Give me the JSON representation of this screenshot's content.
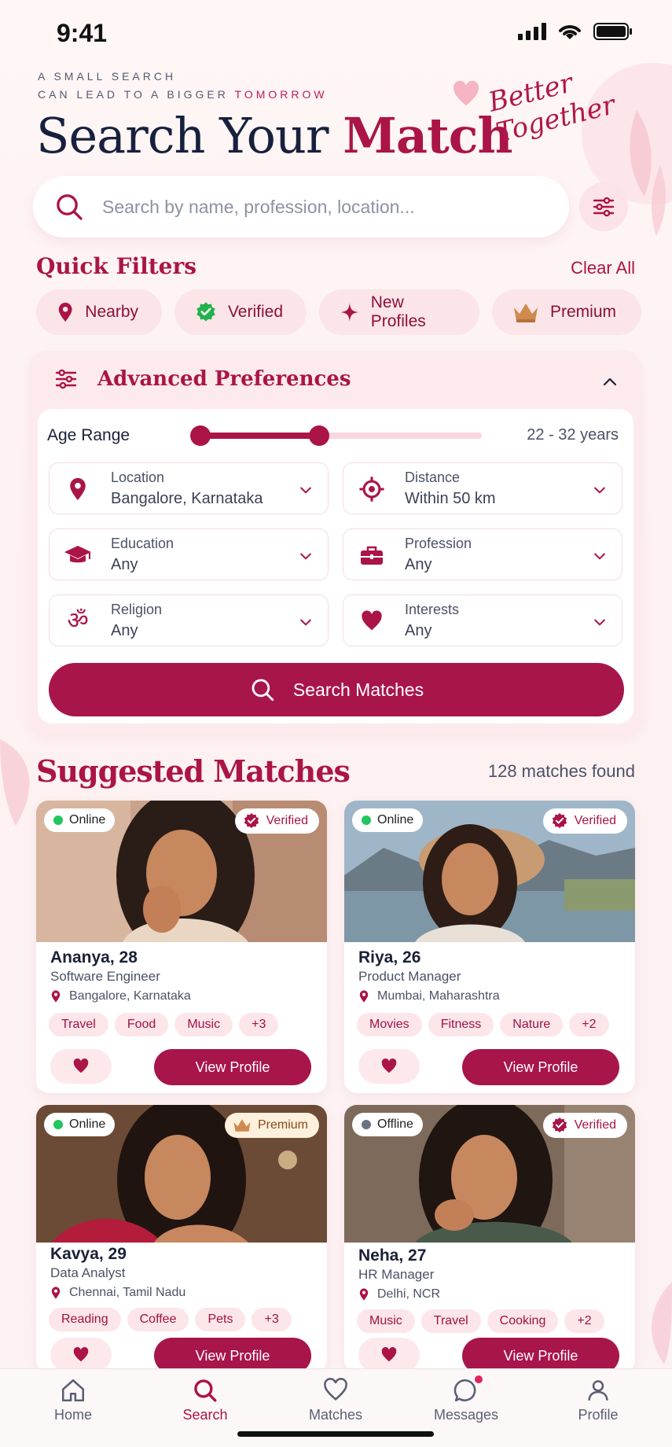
{
  "status_bar": {
    "time": "9:41"
  },
  "hero": {
    "tagline_line1": "A SMALL SEARCH",
    "tagline_line2_prefix": "CAN LEAD TO A BIGGER",
    "tagline_line2_accent": "TOMORROW",
    "title_prefix": "Search Your",
    "title_highlight": "Match",
    "script_line1": "Better",
    "script_line2": "Together"
  },
  "search": {
    "placeholder": "Search by name, profession, location..."
  },
  "quick_filters": {
    "title": "Quick Filters",
    "clear_label": "Clear All",
    "chips": [
      {
        "label": "Nearby",
        "icon": "location-pin-icon"
      },
      {
        "label": "Verified",
        "icon": "verified-check-icon"
      },
      {
        "label": "New Profiles",
        "icon": "sparkle-icon"
      },
      {
        "label": "Premium",
        "icon": "crown-icon"
      }
    ]
  },
  "advanced": {
    "title": "Advanced Preferences",
    "age_label": "Age Range",
    "age_value": "22 - 32 years",
    "fields": [
      {
        "label": "Location",
        "value": "Bangalore, Karnataka",
        "icon": "location-pin-icon"
      },
      {
        "label": "Distance",
        "value": "Within 50 km",
        "icon": "target-icon"
      },
      {
        "label": "Education",
        "value": "Any",
        "icon": "graduation-cap-icon"
      },
      {
        "label": "Profession",
        "value": "Any",
        "icon": "briefcase-icon"
      },
      {
        "label": "Religion",
        "value": "Any",
        "icon": "om-icon"
      },
      {
        "label": "Interests",
        "value": "Any",
        "icon": "heart-icon"
      }
    ],
    "search_button": "Search Matches"
  },
  "suggested": {
    "title": "Suggested Matches",
    "count": "128 matches found",
    "view_label": "View Profile",
    "cards": [
      {
        "name": "Ananya, 28",
        "role": "Software Engineer",
        "location": "Bangalore, Karnataka",
        "status": "Online",
        "badge": "Verified",
        "tags": [
          "Travel",
          "Food",
          "Music",
          "+3"
        ]
      },
      {
        "name": "Riya, 26",
        "role": "Product Manager",
        "location": "Mumbai, Maharashtra",
        "status": "Online",
        "badge": "Verified",
        "tags": [
          "Movies",
          "Fitness",
          "Nature",
          "+2"
        ]
      },
      {
        "name": "Kavya, 29",
        "role": "Data Analyst",
        "location": "Chennai, Tamil Nadu",
        "status": "Online",
        "badge": "Premium",
        "tags": [
          "Reading",
          "Coffee",
          "Pets",
          "+3"
        ]
      },
      {
        "name": "Neha, 27",
        "role": "HR Manager",
        "location": "Delhi, NCR",
        "status": "Offline",
        "badge": "Verified",
        "tags": [
          "Music",
          "Travel",
          "Cooking",
          "+2"
        ]
      }
    ]
  },
  "nav": {
    "items": [
      {
        "label": "Home",
        "icon": "home-icon"
      },
      {
        "label": "Search",
        "icon": "search-icon"
      },
      {
        "label": "Matches",
        "icon": "heart-outline-icon"
      },
      {
        "label": "Messages",
        "icon": "chat-bubble-icon"
      },
      {
        "label": "Profile",
        "icon": "person-icon"
      }
    ],
    "active": "Search"
  },
  "colors": {
    "accent": "#ab1446",
    "online": "#22c55e",
    "offline": "#6b7280",
    "background": "#fdf2f3"
  }
}
